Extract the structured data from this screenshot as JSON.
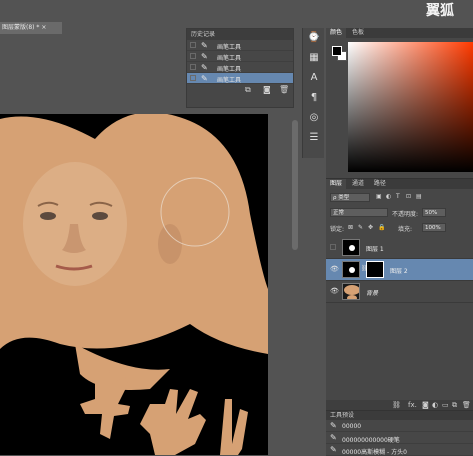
{
  "document": {
    "tab_title": "图层蒙版(8) *",
    "close_label": "×"
  },
  "watermark": "翼狐",
  "history": {
    "title": "历史记录",
    "items": [
      {
        "label": "画笔工具",
        "selected": false
      },
      {
        "label": "画笔工具",
        "selected": false
      },
      {
        "label": "画笔工具",
        "selected": false
      },
      {
        "label": "画笔工具",
        "selected": true
      }
    ]
  },
  "color": {
    "tabs": [
      "颜色",
      "色板"
    ],
    "active_tab": "颜色",
    "foreground": "#000000",
    "background": "#ffffff",
    "hue_color": "#ff3a00"
  },
  "layers_panel": {
    "tabs": [
      "图层",
      "通道",
      "路径"
    ],
    "active_tab": "图层",
    "filter_kind": "ρ 类型",
    "blend_mode": "正常",
    "opacity_label": "不透明度:",
    "opacity_value": "50%",
    "lock_label": "锁定:",
    "fill_label": "填充:",
    "fill_value": "100%",
    "layers": [
      {
        "name": "图层 1",
        "visible": false,
        "selected": false
      },
      {
        "name": "图层 2",
        "visible": true,
        "selected": true,
        "has_mask": true
      },
      {
        "name": "背景",
        "visible": true,
        "selected": false
      }
    ],
    "footer_fx": "fx."
  },
  "tool_presets": {
    "title": "工具预设",
    "items": [
      "00000",
      "000000000000硬笔",
      "00000高斯模糊 - 方头0"
    ]
  },
  "accent_colors": {
    "selection": "#6688b0",
    "panel": "#474747",
    "workspace": "#535353"
  }
}
